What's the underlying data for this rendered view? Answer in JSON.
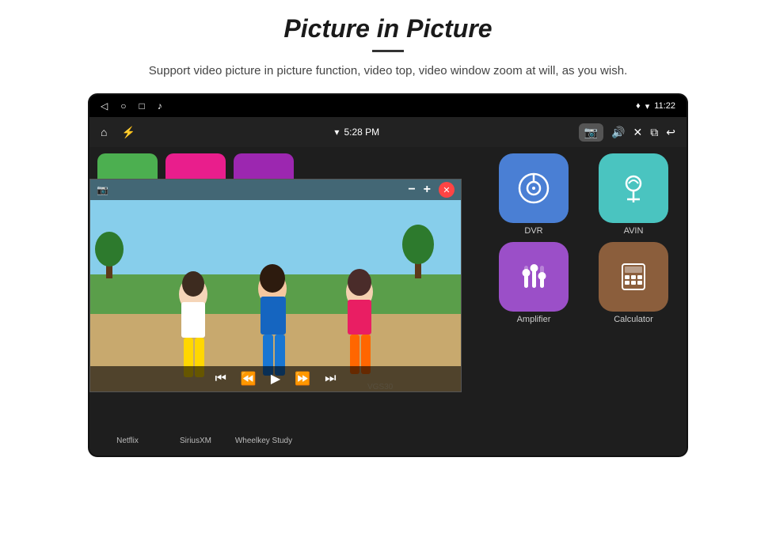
{
  "header": {
    "title": "Picture in Picture",
    "subtitle": "Support video picture in picture function, video top, video window zoom at will, as you wish."
  },
  "statusBar": {
    "time": "11:22",
    "icons": [
      "back",
      "home",
      "recents",
      "music"
    ]
  },
  "toolbar": {
    "time": "5:28 PM",
    "icons": [
      "wifi",
      "camera",
      "volume",
      "close",
      "pip",
      "back"
    ]
  },
  "pipControls": {
    "minus": "−",
    "plus": "+",
    "close": "✕"
  },
  "apps": {
    "topRow": [
      {
        "label": "Netflix",
        "color": "green"
      },
      {
        "label": "SiriusXM",
        "color": "pink"
      },
      {
        "label": "Wheelkey Study",
        "color": "purple"
      }
    ],
    "rightGrid": [
      {
        "label": "DVR",
        "icon": "📡",
        "color": "blue",
        "iconSymbol": "⊙"
      },
      {
        "label": "AVIN",
        "icon": "🎛",
        "color": "teal",
        "iconSymbol": "⚲"
      },
      {
        "label": "Amplifier",
        "icon": "🎚",
        "color": "purple2",
        "iconSymbol": "⫿"
      },
      {
        "label": "Calculator",
        "icon": "🖩",
        "color": "brown",
        "iconSymbol": "⊞"
      }
    ]
  },
  "watermark": "VGS30"
}
